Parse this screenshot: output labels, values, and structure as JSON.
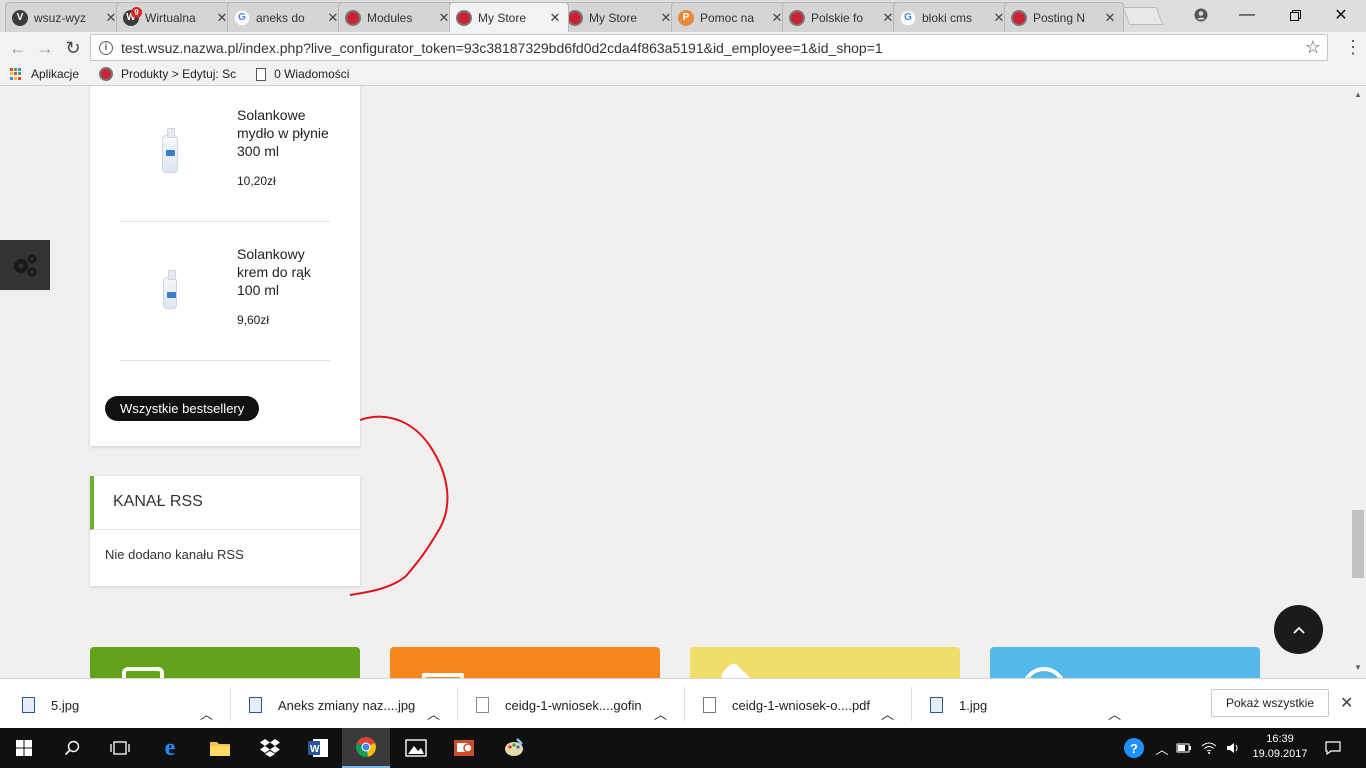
{
  "browser": {
    "tabs": [
      {
        "label": "wsuz-wyz",
        "icon": "vivaldi-icon"
      },
      {
        "label": "Wirtualna",
        "icon": "mail-icon",
        "badge": "9"
      },
      {
        "label": "aneks do",
        "icon": "google-icon"
      },
      {
        "label": "Modules",
        "icon": "prestashop-icon"
      },
      {
        "label": "My Store",
        "icon": "prestashop-icon"
      },
      {
        "label": "My Store",
        "icon": "prestashop-icon"
      },
      {
        "label": "Pomoc na",
        "icon": "help-icon"
      },
      {
        "label": "Polskie fo",
        "icon": "prestashop-icon"
      },
      {
        "label": "bloki cms",
        "icon": "google-icon"
      },
      {
        "label": "Posting N",
        "icon": "prestashop-icon"
      }
    ],
    "url": "test.wsuz.nazwa.pl/index.php?live_configurator_token=93c38187329bd6fd0d2cda4f863a5191&id_employee=1&id_shop=1",
    "bookmarks": {
      "apps": "Aplikacje",
      "products": "Produkty > Edytuj: Sc",
      "messages": "0 Wiadomości"
    }
  },
  "page": {
    "products": [
      {
        "name": "Solankowe mydło w płynie 300 ml",
        "price": "10,20zł"
      },
      {
        "name": "Solankowy krem do rąk 100 ml",
        "price": "9,60zł"
      }
    ],
    "all_bestsellers": "Wszystkie bestsellery",
    "rss": {
      "title": "KANAŁ RSS",
      "empty": "Nie dodano kanału RSS"
    },
    "tile_colors": [
      "#62a31b",
      "#f7861c",
      "#f1dd6c",
      "#52b9e8"
    ],
    "accent": "#6cb22e",
    "annotation_color": "#e0141e"
  },
  "downloads": {
    "items": [
      {
        "name": "5.jpg",
        "type": "image"
      },
      {
        "name": "Aneks zmiany naz....jpg",
        "type": "image"
      },
      {
        "name": "ceidg-1-wniosek....gofin",
        "type": "doc"
      },
      {
        "name": "ceidg-1-wniosek-o....pdf",
        "type": "pdf"
      },
      {
        "name": "1.jpg",
        "type": "image"
      }
    ],
    "show_all": "Pokaż wszystkie"
  },
  "taskbar": {
    "time": "16:39",
    "date": "19.09.2017"
  }
}
